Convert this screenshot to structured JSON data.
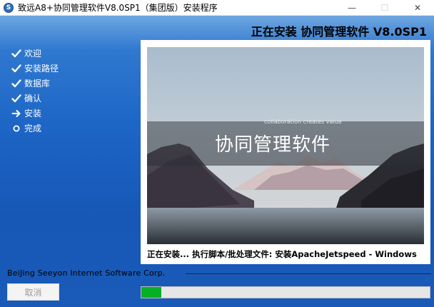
{
  "window": {
    "title": "致远A8+协同管理软件V8.0SP1（集团版）安装程序",
    "minimize_label": "—",
    "maximize_label": "☐",
    "close_label": "✕"
  },
  "header": {
    "title": "正在安装 协同管理软件 V8.0SP1"
  },
  "steps": [
    {
      "label": "欢迎",
      "state": "done"
    },
    {
      "label": "安装路径",
      "state": "done"
    },
    {
      "label": "数据库",
      "state": "done"
    },
    {
      "label": "确认",
      "state": "done"
    },
    {
      "label": "安装",
      "state": "current"
    },
    {
      "label": "完成",
      "state": "pending"
    }
  ],
  "banner": {
    "slogan": "collaboration creates value",
    "heading": "协同管理软件"
  },
  "status": "正在安装... 执行脚本/批处理文件: 安装ApacheJetspeed - Windows",
  "company": "BeiJing Seeyon Internet Software Corp.",
  "cancel_label": "取消",
  "progress": {
    "percent": 7
  },
  "colors": {
    "accent": "#1c64c5",
    "progress": "#06b025"
  }
}
